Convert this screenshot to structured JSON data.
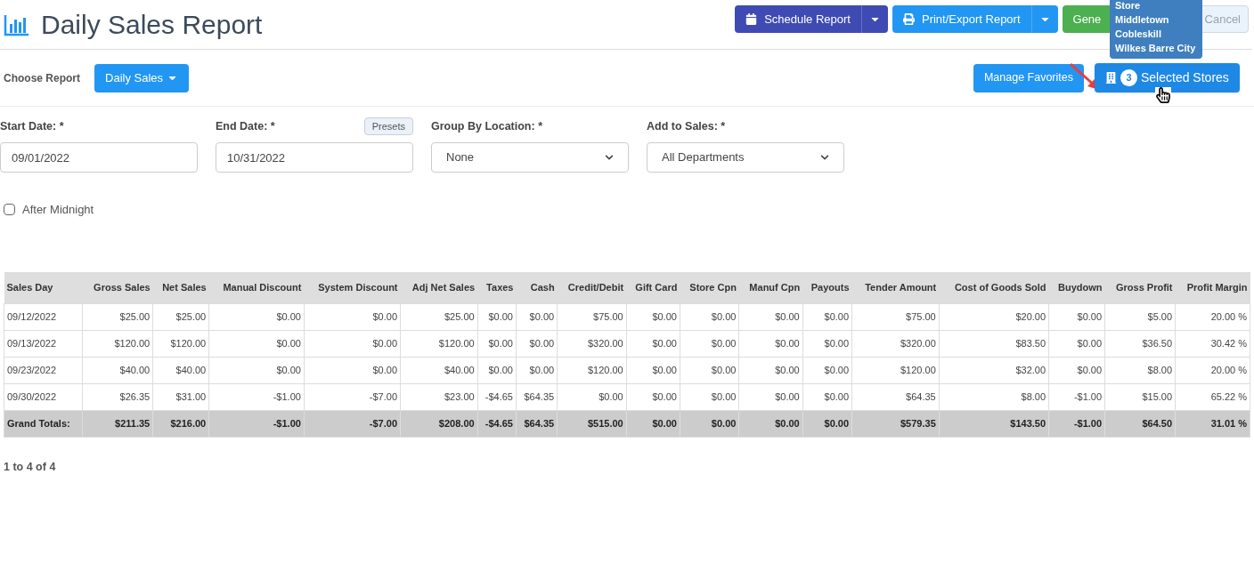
{
  "header": {
    "title": "Daily Sales Report",
    "buttons": [
      {
        "kind": "split",
        "label": "Schedule Report",
        "color": "#3f4bb3"
      },
      {
        "kind": "split",
        "label": "Print/Export Report",
        "color": "#2196f3"
      },
      {
        "kind": "plain",
        "label": "Gene",
        "color": "#4caf50"
      },
      {
        "kind": "outline",
        "label": "Cancel",
        "disabled": true
      }
    ]
  },
  "tooltip": {
    "lines": [
      "Store",
      "Middletown",
      "Cobleskill",
      "Wilkes Barre City"
    ]
  },
  "choose_report": {
    "label": "Choose Report",
    "value": "Daily Sales"
  },
  "manage_favorites": "Manage Favorites",
  "selected_stores": {
    "count": "3",
    "label": "Selected Stores"
  },
  "filters": [
    {
      "kind": "input",
      "label": "Start Date: *",
      "value": "09/01/2022"
    },
    {
      "kind": "input",
      "label": "End Date: *",
      "value": "10/31/2022",
      "extra": "Presets"
    },
    {
      "kind": "select",
      "label": "Group By Location: *",
      "value": "None"
    },
    {
      "kind": "select",
      "label": "Add to Sales: *",
      "value": "All Departments"
    }
  ],
  "after_midnight": {
    "label": "After Midnight",
    "checked": false
  },
  "table": {
    "columns": [
      "Sales Day",
      "Gross Sales",
      "Net Sales",
      "Manual Discount",
      "System Discount",
      "Adj Net Sales",
      "Taxes",
      "Cash",
      "Credit/Debit",
      "Gift Card",
      "Store Cpn",
      "Manuf Cpn",
      "Payouts",
      "Tender Amount",
      "Cost of Goods Sold",
      "Buydown",
      "Gross Profit",
      "Profit Margin"
    ],
    "rows": [
      [
        "09/12/2022",
        "$25.00",
        "$25.00",
        "$0.00",
        "$0.00",
        "$25.00",
        "$0.00",
        "$0.00",
        "$75.00",
        "$0.00",
        "$0.00",
        "$0.00",
        "$0.00",
        "$75.00",
        "$20.00",
        "$0.00",
        "$5.00",
        "20.00 %"
      ],
      [
        "09/13/2022",
        "$120.00",
        "$120.00",
        "$0.00",
        "$0.00",
        "$120.00",
        "$0.00",
        "$0.00",
        "$320.00",
        "$0.00",
        "$0.00",
        "$0.00",
        "$0.00",
        "$320.00",
        "$83.50",
        "$0.00",
        "$36.50",
        "30.42 %"
      ],
      [
        "09/23/2022",
        "$40.00",
        "$40.00",
        "$0.00",
        "$0.00",
        "$40.00",
        "$0.00",
        "$0.00",
        "$120.00",
        "$0.00",
        "$0.00",
        "$0.00",
        "$0.00",
        "$120.00",
        "$32.00",
        "$0.00",
        "$8.00",
        "20.00 %"
      ],
      [
        "09/30/2022",
        "$26.35",
        "$31.00",
        "-$1.00",
        "-$7.00",
        "$23.00",
        "-$4.65",
        "$64.35",
        "$0.00",
        "$0.00",
        "$0.00",
        "$0.00",
        "$0.00",
        "$64.35",
        "$8.00",
        "-$1.00",
        "$15.00",
        "65.22 %"
      ]
    ],
    "totals": [
      "Grand Totals:",
      "$211.35",
      "$216.00",
      "-$1.00",
      "-$7.00",
      "$208.00",
      "-$4.65",
      "$64.35",
      "$515.00",
      "$0.00",
      "$0.00",
      "$0.00",
      "$0.00",
      "$579.35",
      "$143.50",
      "-$1.00",
      "$64.50",
      "31.01 %"
    ]
  },
  "pagination": "1 to 4 of 4"
}
